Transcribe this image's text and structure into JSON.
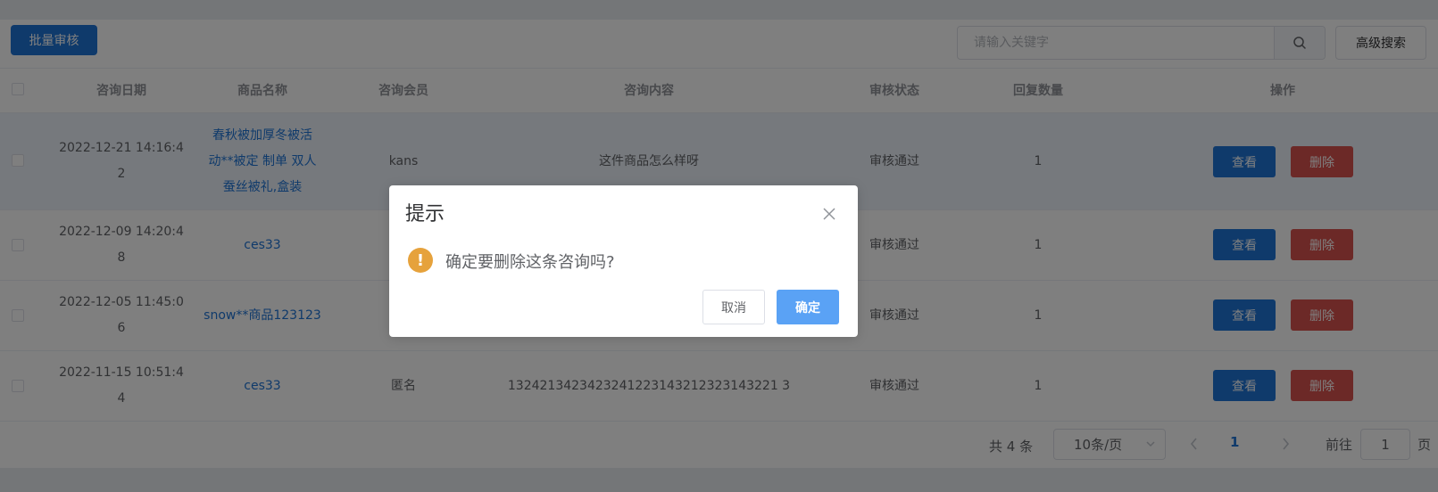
{
  "toolbar": {
    "batch_review_label": "批量审核",
    "search_placeholder": "请输入关键字",
    "advanced_search_label": "高级搜索"
  },
  "table": {
    "headers": {
      "date": "咨询日期",
      "goods": "商品名称",
      "member": "咨询会员",
      "content": "咨询内容",
      "status": "审核状态",
      "reply_count": "回复数量",
      "actions": "操作"
    },
    "rows": [
      {
        "date_line1": "2022-12-21 14:16:4",
        "date_line2": "2",
        "goods_line1": "春秋被加厚冬被活",
        "goods_line2": "动**被定 制单 双人",
        "goods_line3": "蚕丝被礼,盒装",
        "member": "kans",
        "content": "这件商品怎么样呀",
        "status": "审核通过",
        "reply_count": "1",
        "view_label": "查看",
        "delete_label": "删除"
      },
      {
        "date_line1": "2022-12-09 14:20:4",
        "date_line2": "8",
        "goods": "ces33",
        "member": "",
        "content": "",
        "status": "审核通过",
        "reply_count": "1",
        "view_label": "查看",
        "delete_label": "删除"
      },
      {
        "date_line1": "2022-12-05 11:45:0",
        "date_line2": "6",
        "goods": "snow**商品123123",
        "member": "",
        "content": "",
        "status": "审核通过",
        "reply_count": "1",
        "view_label": "查看",
        "delete_label": "删除"
      },
      {
        "date_line1": "2022-11-15 10:51:4",
        "date_line2": "4",
        "goods": "ces33",
        "member": "匿名",
        "content": "1324213423423241223143212323143221 3",
        "status": "审核通过",
        "reply_count": "1",
        "view_label": "查看",
        "delete_label": "删除"
      }
    ]
  },
  "pagination": {
    "total_text": "共 4 条",
    "page_size": "10条/页",
    "current_page": "1",
    "goto_label": "前往",
    "goto_value": "1",
    "page_suffix": "页"
  },
  "dialog": {
    "title": "提示",
    "message": "确定要删除这条咨询吗?",
    "warn_glyph": "!",
    "cancel_label": "取消",
    "confirm_label": "确定"
  },
  "colors": {
    "primary": "#1f74d6",
    "danger": "#d9534f",
    "warning": "#e6a23c",
    "confirm": "#5aa2f5"
  }
}
